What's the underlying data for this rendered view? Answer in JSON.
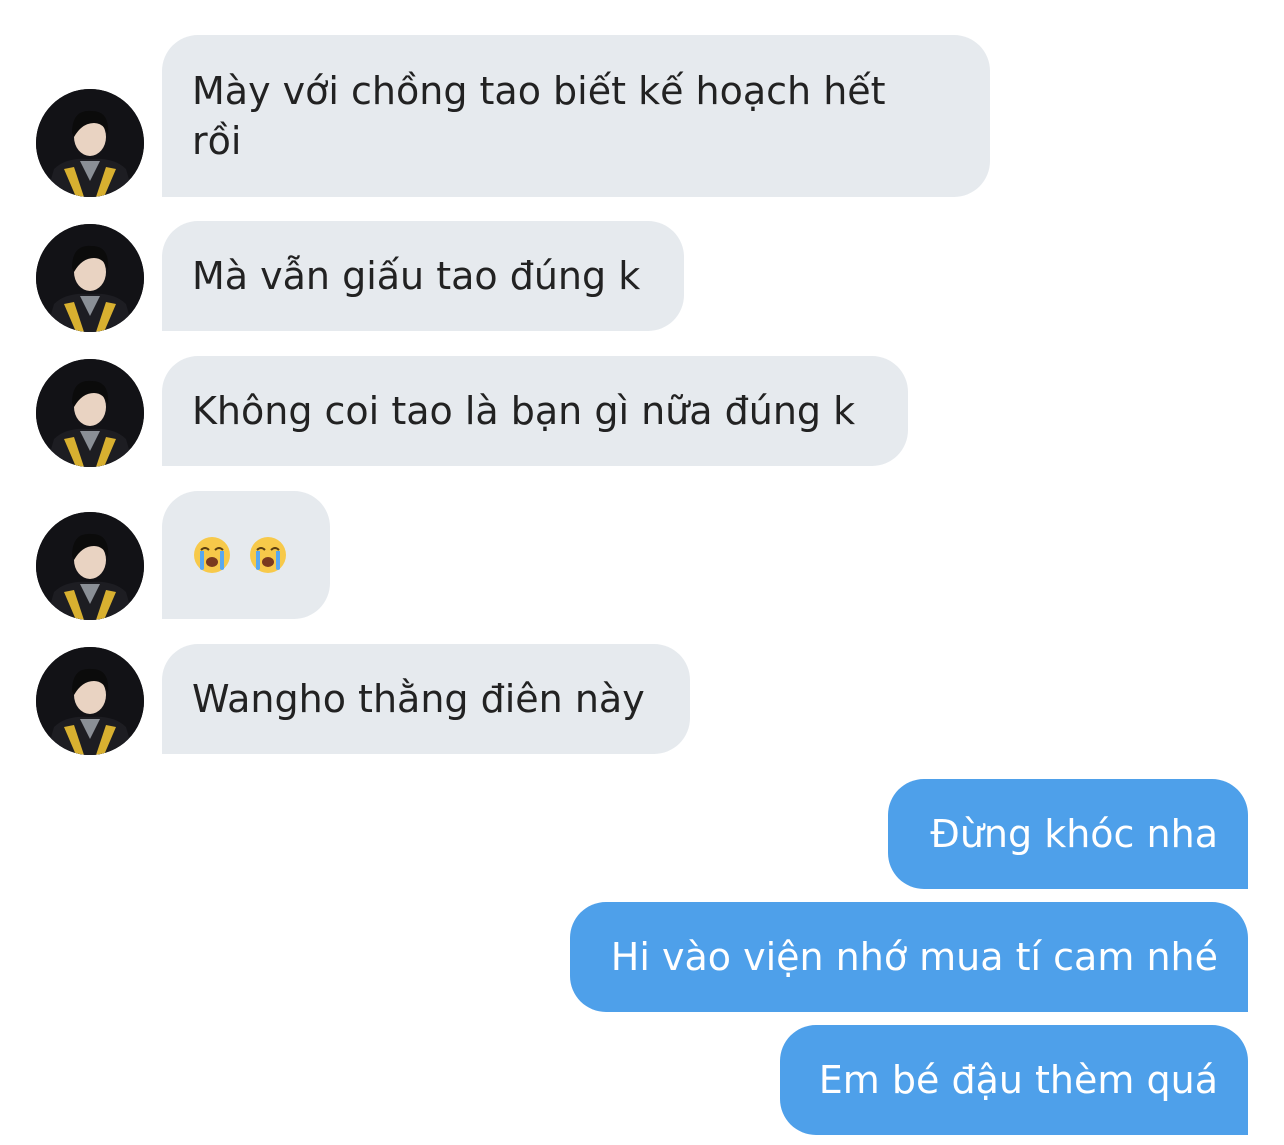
{
  "colors": {
    "incoming_bubble": "#e6eaee",
    "outgoing_bubble": "#4ea0ea",
    "incoming_text": "#222222",
    "outgoing_text": "#ffffff"
  },
  "incoming_messages": [
    {
      "text": "Mày với chồng tao biết kế hoạch hết rồi"
    },
    {
      "text": "Mà vẫn giấu tao đúng k"
    },
    {
      "text": "Không coi tao là bạn gì nữa đúng k"
    },
    {
      "emojis": [
        "loudly-crying-face-icon",
        "loudly-crying-face-icon"
      ]
    },
    {
      "text": "Wangho thằng điên này"
    }
  ],
  "outgoing_messages": [
    {
      "text": "Đừng khóc nha"
    },
    {
      "text": "Hi vào viện nhớ mua tí cam nhé"
    },
    {
      "text": "Em bé đậu thèm quá"
    }
  ]
}
